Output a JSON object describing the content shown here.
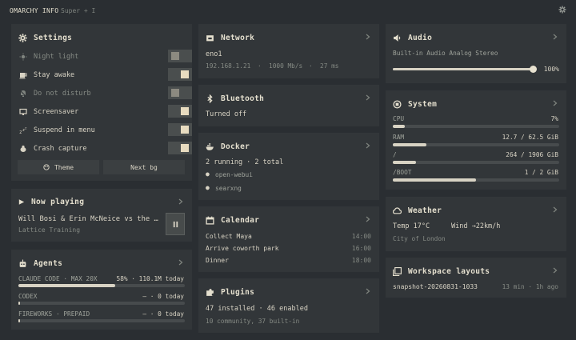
{
  "topbar": {
    "title": "OMARCHY INFO",
    "shortcut": "Super + I",
    "settings_icon": "gear-icon"
  },
  "settings": {
    "title": "Settings",
    "items": [
      {
        "label": "Night light",
        "on": false,
        "icon": "sun-dim-icon"
      },
      {
        "label": "Stay awake",
        "on": true,
        "icon": "coffee-icon"
      },
      {
        "label": "Do not disturb",
        "on": false,
        "icon": "bell-off-icon"
      },
      {
        "label": "Screensaver",
        "on": true,
        "icon": "monitor-icon"
      },
      {
        "label": "Suspend in menu",
        "on": true,
        "icon": "sleep-icon"
      },
      {
        "label": "Crash capture",
        "on": true,
        "icon": "bug-icon"
      }
    ],
    "theme_label": "Theme",
    "nextbg_label": "Next bg"
  },
  "now_playing": {
    "title": "Now playing",
    "track": "Will Bosi & Erin McNeice vs the …",
    "subtitle": "Lattice Training"
  },
  "agents": {
    "title": "Agents",
    "rows": [
      {
        "name": "CLAUDE CODE · MAX 20X",
        "value": "58% · 110.1M today",
        "percent": 58
      },
      {
        "name": "CODEX",
        "value": "– · 0 today",
        "percent": 1
      },
      {
        "name": "FIREWORKS · PREPAID",
        "value": "– · 0 today",
        "percent": 1
      }
    ]
  },
  "network": {
    "title": "Network",
    "iface": "eno1",
    "ip": "192.168.1.21",
    "speed": "1000 Mb/s",
    "latency": "27 ms"
  },
  "bluetooth": {
    "title": "Bluetooth",
    "status": "Turned off"
  },
  "docker": {
    "title": "Docker",
    "summary": "2 running · 2 total",
    "containers": [
      "open-webui",
      "searxng"
    ]
  },
  "calendar": {
    "title": "Calendar",
    "events": [
      {
        "name": "Collect Maya",
        "time": "14:00"
      },
      {
        "name": "Arrive coworth park",
        "time": "16:00"
      },
      {
        "name": "Dinner",
        "time": "18:00"
      }
    ]
  },
  "plugins": {
    "title": "Plugins",
    "summary": "47 installed · 46 enabled",
    "detail": "10 community, 37 built-in"
  },
  "audio": {
    "title": "Audio",
    "device": "Built-in Audio Analog Stereo",
    "volume_label": "100%",
    "volume": 100
  },
  "system": {
    "title": "System",
    "rows": [
      {
        "name": "CPU",
        "value": "7%",
        "percent": 7
      },
      {
        "name": "RAM",
        "value": "12.7 / 62.5 GiB",
        "percent": 20
      },
      {
        "name": "/",
        "value": "264 / 1906 GiB",
        "percent": 14
      },
      {
        "name": "/BOOT",
        "value": "1 / 2 GiB",
        "percent": 50
      }
    ]
  },
  "weather": {
    "title": "Weather",
    "temp": "Temp 17°C",
    "wind": "Wind →22km/h",
    "location": "City of London"
  },
  "workspace": {
    "title": "Workspace layouts",
    "snapshot": "snapshot-20260831-1033",
    "meta": "13 min · 1h ago"
  }
}
